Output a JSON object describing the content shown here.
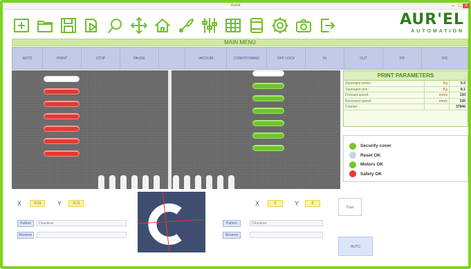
{
  "window": {
    "title": "Aurel",
    "minimize": "–",
    "maximize": "□",
    "close": "×"
  },
  "toolbar": {
    "icons": [
      "new-icon",
      "open-icon",
      "save-icon",
      "export-icon",
      "search-icon",
      "move-icon",
      "home-icon",
      "tool-icon",
      "sliders-icon",
      "grid-icon",
      "window-icon",
      "settings-icon",
      "camera-icon",
      "exit-icon"
    ]
  },
  "logo": {
    "main": "AUR'EL",
    "sub": "AUTOMATION"
  },
  "main_menu": {
    "label": "MAIN MENU"
  },
  "menu_buttons": [
    "AUTO",
    "PRINT",
    "STOP",
    "PAUSE",
    "",
    "VACUUM",
    "CONDITIONING",
    "OFF LOCK",
    "IN",
    "OUT",
    "F/F",
    "F/S"
  ],
  "print_params": {
    "title": "PRINT PARAMETERS",
    "rows": [
      {
        "label": "Squeegee press:",
        "unit": "Kg",
        "value": "5.0"
      },
      {
        "label": "Squeegee pos.:",
        "unit": "Kg",
        "value": "8.1"
      },
      {
        "label": "Forward speed:",
        "unit": "mm/s",
        "value": "130"
      },
      {
        "label": "Backward speed:",
        "unit": "mm/s",
        "value": "330"
      },
      {
        "label": "Counter:",
        "unit": "",
        "value": "37946"
      }
    ]
  },
  "status": [
    {
      "label": "Security cover",
      "color": "#7cc428"
    },
    {
      "label": "Reset OK",
      "color": "#c8d2e6"
    },
    {
      "label": "Motors OK",
      "color": "#7cc428"
    },
    {
      "label": "Safety OK",
      "color": "#e53935"
    }
  ],
  "left_controls": {
    "x_label": "X",
    "x_value": "-0.01",
    "y_label": "Y",
    "y_value": "-0.11",
    "pattern_btn": "Pattern",
    "pattern_field": "Chucknar",
    "reverse_btn": "Reverse",
    "reverse_field": ""
  },
  "right_controls": {
    "x_label": "X",
    "x_value": "0",
    "y_label": "Y",
    "y_value": "0",
    "pattern_btn": "Pattern",
    "pattern_field": "Chucknar",
    "reverse_btn": "Reverse",
    "reverse_field": ""
  },
  "buttons": {
    "train": "Train",
    "auto": "AUTO"
  }
}
